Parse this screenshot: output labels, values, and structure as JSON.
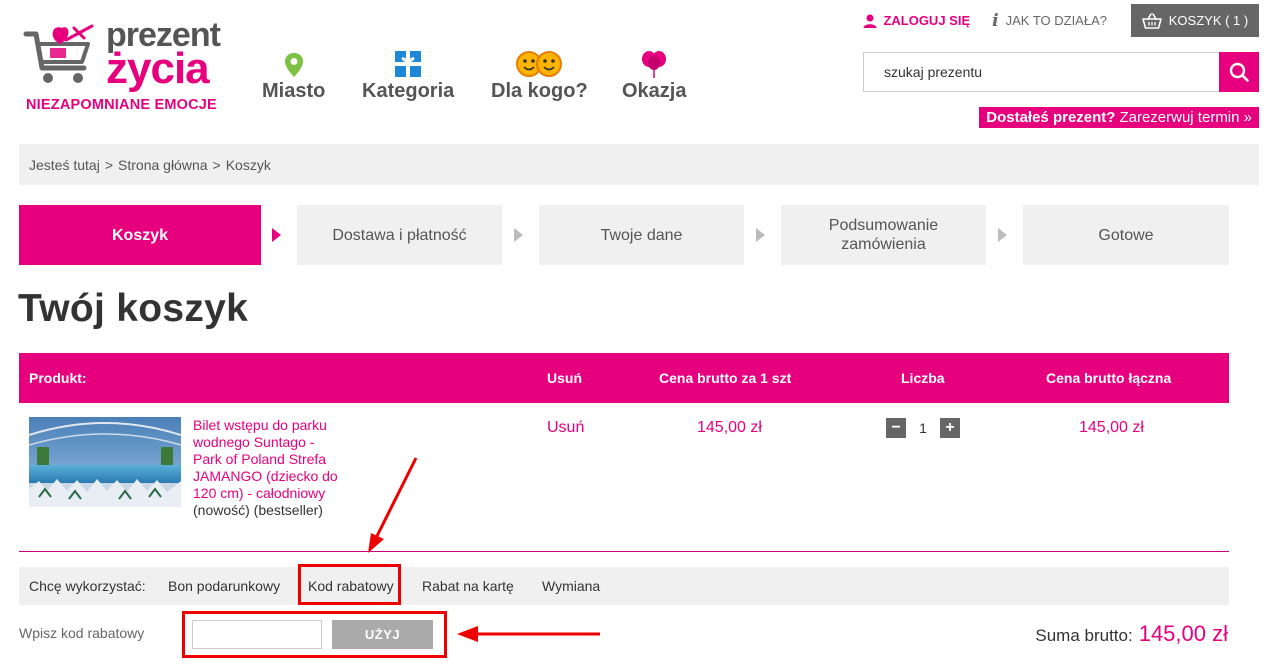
{
  "brand": {
    "name_line1": "prezent",
    "name_line2": "życia",
    "tagline": "NIEZAPOMNIANE EMOCJE",
    "colors": {
      "accent": "#e6007e",
      "gray": "#555555",
      "annotation": "#ee0000"
    }
  },
  "nav": [
    {
      "label": "Miasto",
      "icon": "map-pin-icon"
    },
    {
      "label": "Kategoria",
      "icon": "gift-icon"
    },
    {
      "label": "Dla kogo?",
      "icon": "faces-icon"
    },
    {
      "label": "Okazja",
      "icon": "balloons-icon"
    }
  ],
  "top": {
    "login": "ZALOGUJ SIĘ",
    "help": "JAK TO DZIAŁA?",
    "cart": "KOSZYK ( 1 )"
  },
  "search": {
    "value": "szukaj prezentu"
  },
  "promo": {
    "bold": "Dostałeś prezent?",
    "rest": "Zarezerwuj termin »"
  },
  "breadcrumb": [
    "Jesteś tutaj",
    ">",
    "Strona główna",
    ">",
    "Koszyk"
  ],
  "steps": [
    {
      "label": "Koszyk",
      "active": true
    },
    {
      "label": "Dostawa i płatność",
      "active": false
    },
    {
      "label": "Twoje dane",
      "active": false
    },
    {
      "label": "Podsumowanie zamówienia",
      "active": false
    },
    {
      "label": "Gotowe",
      "active": false
    }
  ],
  "page_title": "Twój koszyk",
  "table": {
    "headers": [
      "Produkt:",
      "Usuń",
      "Cena brutto za 1 szt",
      "Liczba",
      "Cena brutto łączna"
    ],
    "rows": [
      {
        "name": "Bilet wstępu do parku wodnego Suntago - Park of Poland Strefa JAMANGO (dziecko do 120 cm) - całodniowy",
        "tags": "(nowość) (bestseller)",
        "remove": "Usuń",
        "unit_price": "145,00 zł",
        "qty": "1",
        "qty_minus": "−",
        "qty_plus": "+",
        "total": "145,00 zł"
      }
    ]
  },
  "discount": {
    "label": "Chcę wykorzystać:",
    "tabs": [
      "Bon podarunkowy",
      "Kod rabatowy",
      "Rabat na kartę",
      "Wymiana"
    ],
    "selected": "Kod rabatowy",
    "code_label": "Wpisz kod rabatowy",
    "code_value": "",
    "use_button": "UŻYJ"
  },
  "summary": {
    "label": "Suma brutto:",
    "value": "145,00 zł"
  }
}
